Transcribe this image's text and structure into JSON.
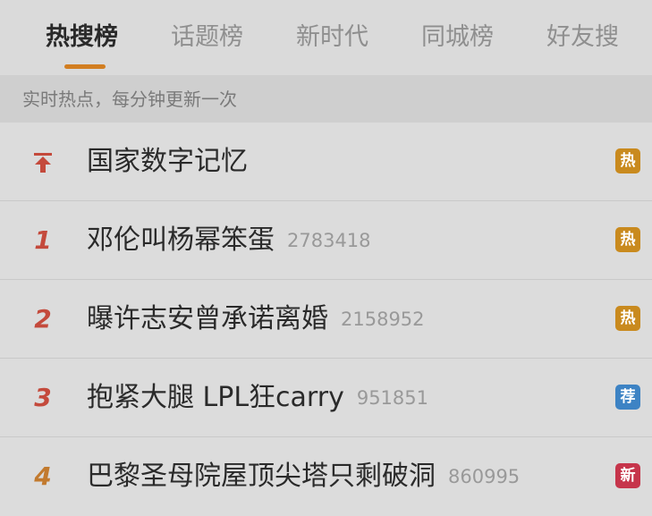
{
  "tabs": [
    {
      "label": "热搜榜",
      "active": true
    },
    {
      "label": "话题榜",
      "active": false
    },
    {
      "label": "新时代",
      "active": false
    },
    {
      "label": "同城榜",
      "active": false
    },
    {
      "label": "好友搜",
      "active": false
    }
  ],
  "subtitle": "实时热点，每分钟更新一次",
  "items": [
    {
      "rank_icon": "pin-top-icon",
      "title": "国家数字记忆",
      "count": "",
      "badge": "热",
      "badge_color": "#c98a1e"
    },
    {
      "rank": "1",
      "title": "邓伦叫杨幂笨蛋",
      "count": "2783418",
      "badge": "热",
      "badge_color": "#c98a1e"
    },
    {
      "rank": "2",
      "title": "曝许志安曾承诺离婚",
      "count": "2158952",
      "badge": "热",
      "badge_color": "#c98a1e"
    },
    {
      "rank": "3",
      "title": "抱紧大腿 LPL狂carry",
      "count": "951851",
      "badge": "荐",
      "badge_color": "#3d83c4"
    },
    {
      "rank": "4",
      "title": "巴黎圣母院屋顶尖塔只剩破洞",
      "count": "860995",
      "badge": "新",
      "badge_color": "#c6354b"
    }
  ],
  "colors": {
    "accent_underline": "#d27e21",
    "rank_red": "#c44a3c",
    "rank_orange": "#c27a2e"
  }
}
